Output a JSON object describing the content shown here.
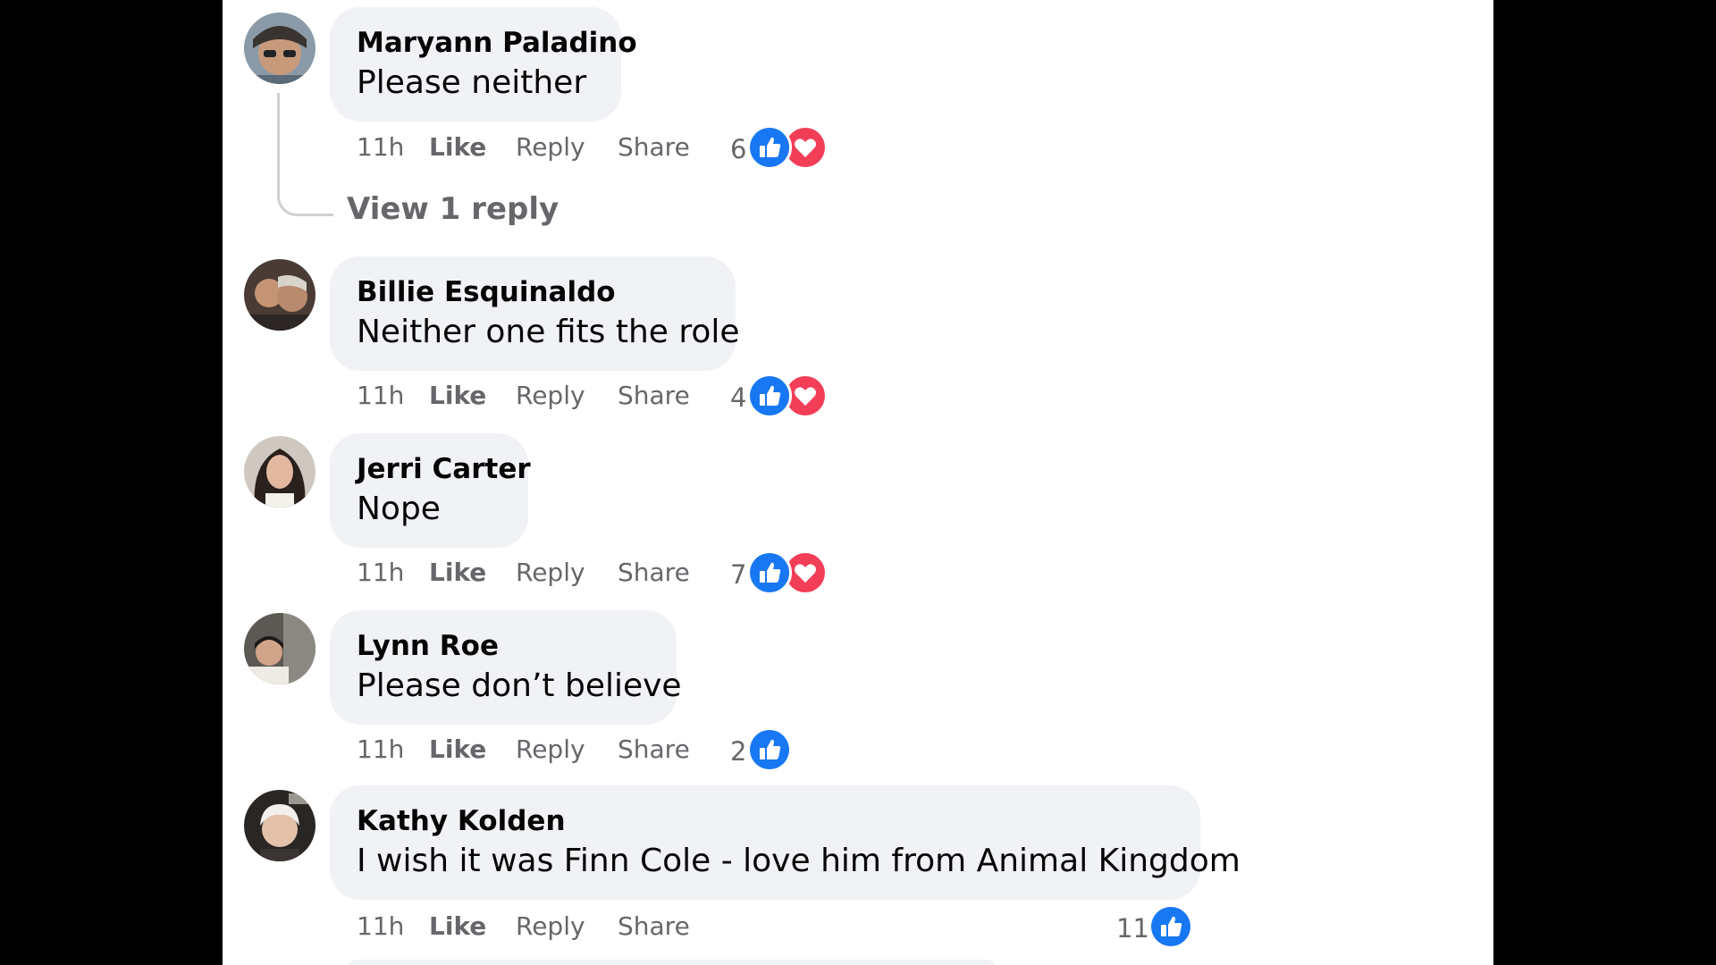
{
  "colors": {
    "like_blue": "#1877f2",
    "love_red": "#f33e58",
    "bubble_bg": "#f0f2f5",
    "meta_text": "#65676b"
  },
  "action_labels": {
    "like": "Like",
    "reply": "Reply",
    "share": "Share"
  },
  "view_reply_label": "View 1 reply",
  "comments": [
    {
      "author": "Maryann Paladino",
      "text": "Please neither",
      "time": "11h",
      "reaction_count": "6",
      "reactions": [
        "like-icon",
        "love-icon"
      ]
    },
    {
      "author": "Billie Esquinaldo",
      "text": "Neither one fits the role",
      "time": "11h",
      "reaction_count": "4",
      "reactions": [
        "like-icon",
        "love-icon"
      ]
    },
    {
      "author": "Jerri Carter",
      "text": "Nope",
      "time": "11h",
      "reaction_count": "7",
      "reactions": [
        "like-icon",
        "love-icon"
      ]
    },
    {
      "author": "Lynn Roe",
      "text": "Please don’t believe",
      "time": "11h",
      "reaction_count": "2",
      "reactions": [
        "like-icon"
      ]
    },
    {
      "author": "Kathy Kolden",
      "text": "I wish it was Finn Cole - love him from Animal Kingdom",
      "time": "11h",
      "reaction_count": "11",
      "reactions": [
        "like-icon"
      ]
    }
  ]
}
